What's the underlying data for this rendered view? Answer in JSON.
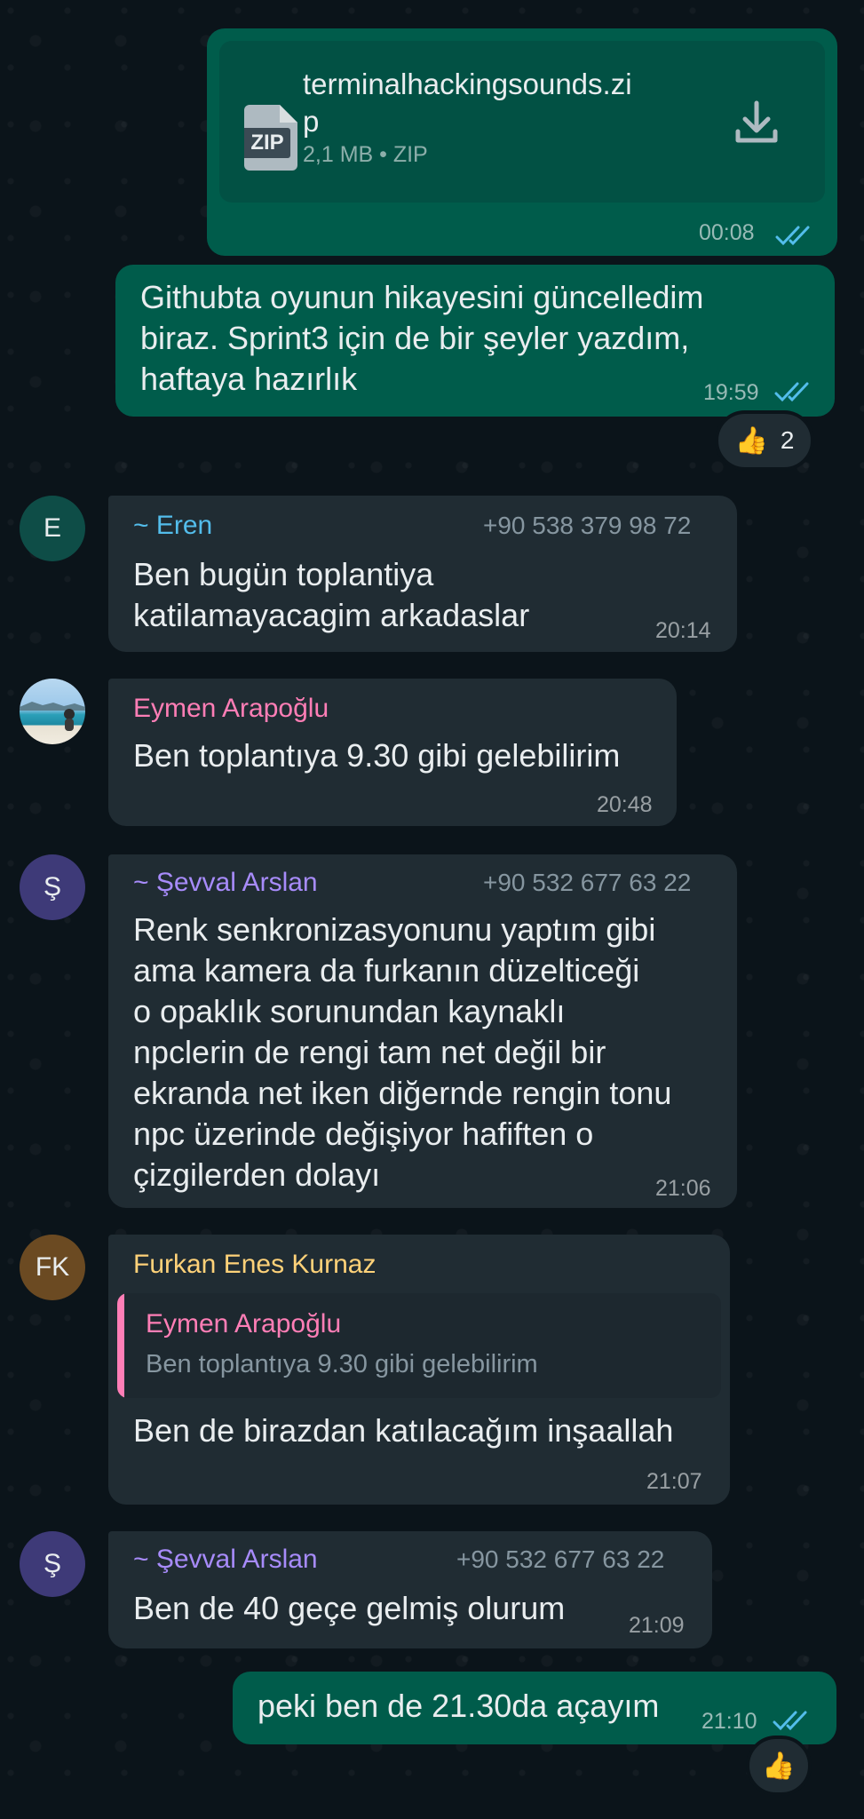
{
  "file_message": {
    "file_icon_label": "ZIP",
    "file_name": "terminalhackingsounds.zi\np",
    "file_meta": "2,1 MB • ZIP",
    "time": "00:08",
    "download_icon": "download-icon"
  },
  "outgoing_1": {
    "text": "Githubta oyunun hikayesini güncelledim\nbiraz. Sprint3 için de bir şeyler yazdım,\nhaftaya hazırlık",
    "time": "19:59",
    "reaction_emoji": "👍",
    "reaction_count": "2"
  },
  "msg_eren": {
    "avatar_initial": "E",
    "sender": "~ Eren",
    "phone": "+90 538 379 98 72",
    "text": "Ben bugün toplantiya\nkatilamayacagim arkadaslar",
    "time": "20:14",
    "sender_color": "#53bdeb"
  },
  "msg_eymen": {
    "sender": "Eymen Arapoğlu",
    "text": "Ben toplantıya 9.30 gibi gelebilirim",
    "time": "20:48",
    "sender_color": "#ff7eb6"
  },
  "msg_sevval_1": {
    "avatar_initial": "Ş",
    "sender": "~ Şevval Arslan",
    "phone": "+90 532 677 63 22",
    "text": "Renk senkronizasyonunu yaptım gibi\nama kamera da furkanın düzelticeği\no opaklık sorunundan kaynaklı\nnpclerin de rengi tam net değil bir\nekranda net iken diğernde rengin tonu\nnpc üzerinde değişiyor hafiften o\nçizgilerden dolayı",
    "time": "21:06",
    "sender_color": "#a78bfa"
  },
  "msg_furkan": {
    "avatar_initial": "FK",
    "sender": "Furkan Enes Kurnaz",
    "quote_sender": "Eymen Arapoğlu",
    "quote_text": "Ben toplantıya 9.30 gibi gelebilirim",
    "text": "Ben de birazdan katılacağım inşaallah",
    "time": "21:07",
    "sender_color": "#ffd279"
  },
  "msg_sevval_2": {
    "avatar_initial": "Ş",
    "sender": "~ Şevval Arslan",
    "phone": "+90 532 677 63 22",
    "text": "Ben de 40 geçe gelmiş olurum",
    "time": "21:09",
    "sender_color": "#a78bfa"
  },
  "outgoing_2": {
    "text": "peki ben de 21.30da açayım",
    "time": "21:10",
    "reaction_emoji": "👍"
  },
  "colors": {
    "outgoing_bubble": "#005c4b",
    "incoming_bubble": "#202c33",
    "read_ticks": "#53bdeb",
    "background": "#0b141a"
  }
}
